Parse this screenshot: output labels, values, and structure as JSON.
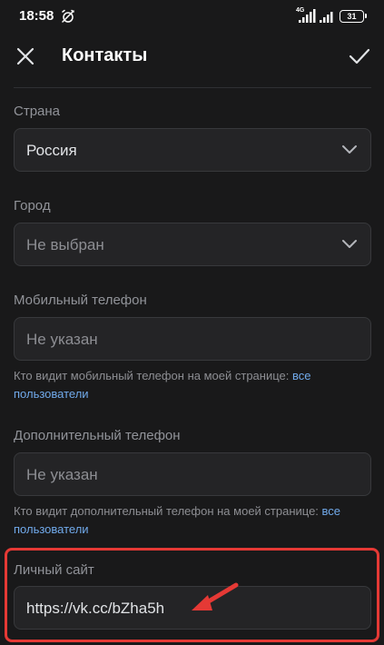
{
  "status_bar": {
    "time": "18:58",
    "network_type": "4G",
    "battery": "31"
  },
  "header": {
    "title": "Контакты",
    "close_icon": "close-icon",
    "done_icon": "checkmark-icon"
  },
  "form": {
    "country": {
      "label": "Страна",
      "value": "Россия"
    },
    "city": {
      "label": "Город",
      "placeholder": "Не выбран"
    },
    "mobile_phone": {
      "label": "Мобильный телефон",
      "placeholder": "Не указан",
      "privacy_text": "Кто видит мобильный телефон на моей странице: ",
      "privacy_link": "все пользователи"
    },
    "extra_phone": {
      "label": "Дополнительный телефон",
      "placeholder": "Не указан",
      "privacy_text": "Кто видит дополнительный телефон на моей странице: ",
      "privacy_link": "все пользователи"
    },
    "website": {
      "label": "Личный сайт",
      "value": "https://vk.cc/bZha5h"
    }
  },
  "colors": {
    "background": "#19191a",
    "field_background": "#242426",
    "link": "#71aaeb",
    "annotation": "#e53935"
  }
}
